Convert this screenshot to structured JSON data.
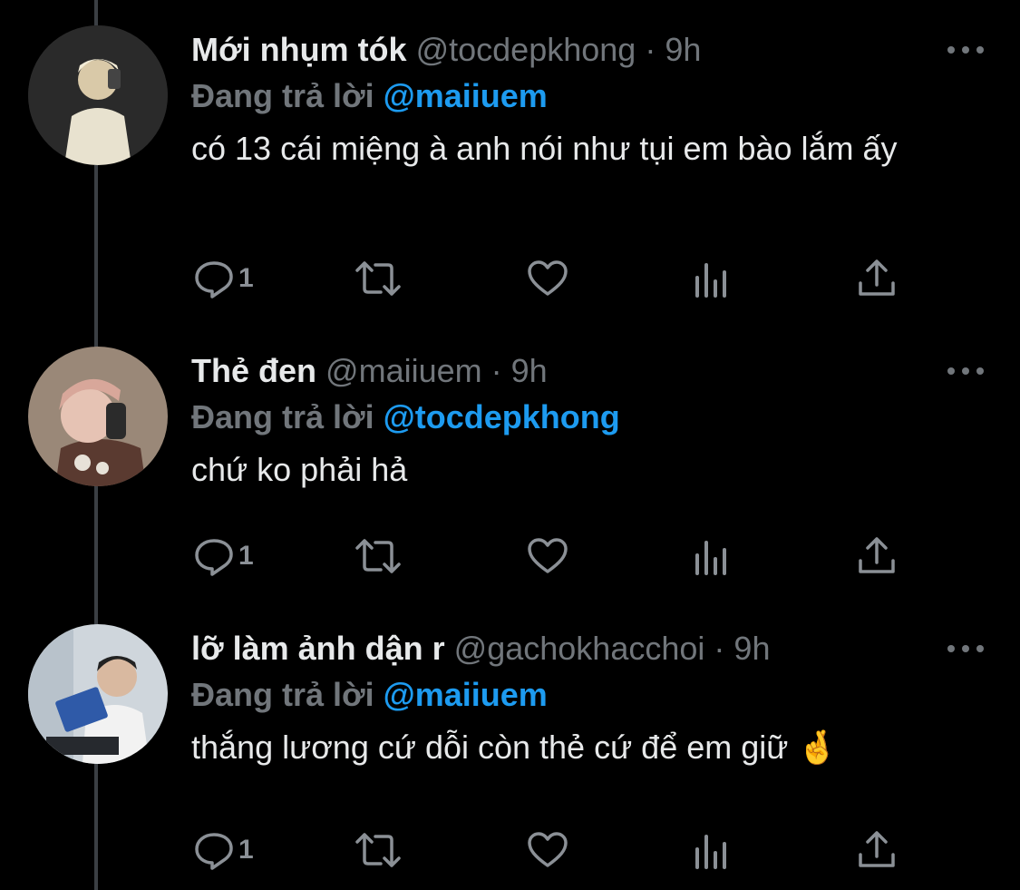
{
  "tweets": [
    {
      "name": "Mới nhụm tók",
      "handle": "@tocdepkhong",
      "time": "9h",
      "replying_prefix": "Đang trả lời",
      "replying_to": "@maiiuem",
      "text": "có 13 cái miệng à anh nói như tụi em bào lắm ấy",
      "reply_count": "1",
      "avatar": {
        "bg": "#2a2a2a",
        "accent": "#e8e2cf"
      }
    },
    {
      "name": "Thẻ đen",
      "handle": "@maiiuem",
      "time": "9h",
      "replying_prefix": "Đang trả lời",
      "replying_to": "@tocdepkhong",
      "text": "chứ ko phải hả",
      "reply_count": "1",
      "avatar": {
        "bg": "#9a8878",
        "accent": "#d8a79a"
      }
    },
    {
      "name": "lỡ làm ảnh dận r",
      "handle": "@gachokhacchoi",
      "time": "9h",
      "replying_prefix": "Đang trả lời",
      "replying_to": "@maiiuem",
      "text": "thắng lương cứ dỗi còn thẻ cứ để em giữ 🤞",
      "reply_count": "1",
      "avatar": {
        "bg": "#cfd6dc",
        "accent": "#2f5aa8"
      }
    }
  ],
  "colors": {
    "background": "#000000",
    "primary_text": "#e7e9ea",
    "secondary_text": "#71767b",
    "mention": "#1d9bf0",
    "thread_line": "#3b3f44"
  },
  "icons": [
    "reply-icon",
    "retweet-icon",
    "like-icon",
    "analytics-icon",
    "share-icon",
    "more-icon"
  ]
}
